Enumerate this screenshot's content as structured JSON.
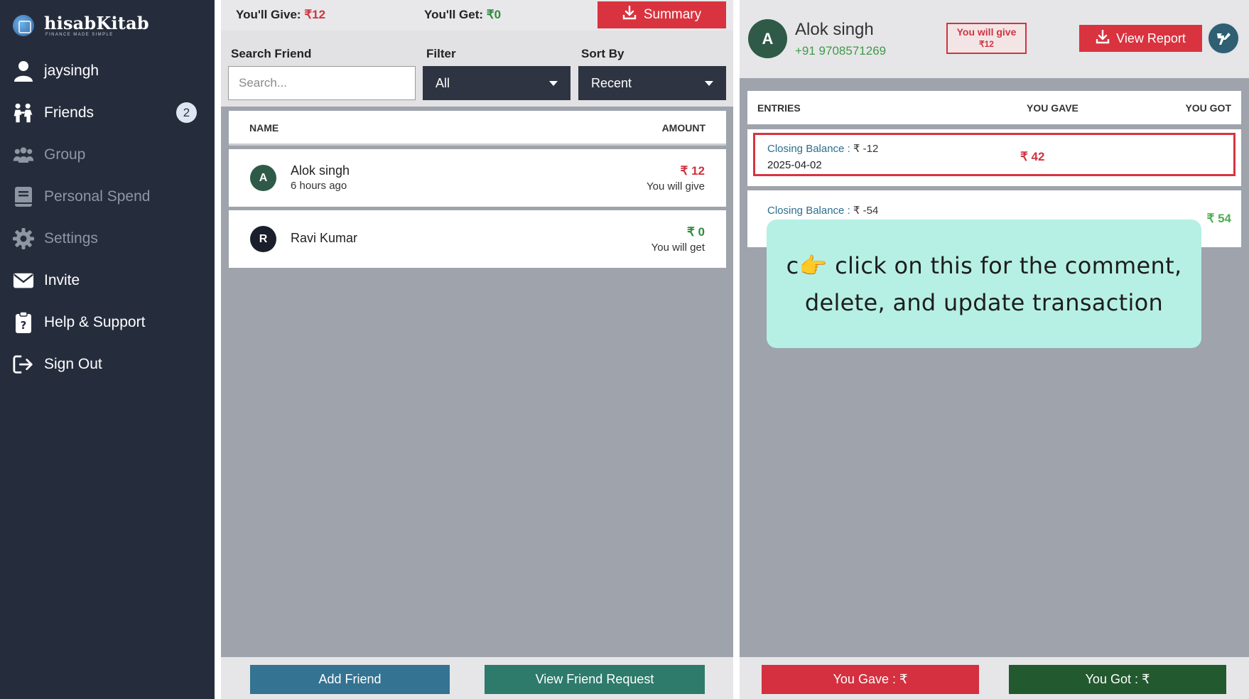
{
  "sidebar": {
    "brand": {
      "name": "hisabKitab",
      "tagline": "FINANCE MADE SIMPLE"
    },
    "items": [
      {
        "label": "jaysingh",
        "icon": "user-icon"
      },
      {
        "label": "Friends",
        "icon": "friends-icon",
        "badge": "2"
      },
      {
        "label": "Group",
        "icon": "group-icon"
      },
      {
        "label": "Personal Spend",
        "icon": "book-icon"
      },
      {
        "label": "Settings",
        "icon": "gear-icon"
      },
      {
        "label": "Invite",
        "icon": "envelope-icon"
      },
      {
        "label": "Help & Support",
        "icon": "clipboard-question-icon"
      },
      {
        "label": "Sign Out",
        "icon": "sign-out-icon"
      }
    ]
  },
  "summary_bar": {
    "give_label": "You'll Give:",
    "give_value": "₹12",
    "get_label": "You'll Get:",
    "get_value": "₹0",
    "summary_button": "Summary"
  },
  "filters": {
    "search_label": "Search Friend",
    "search_placeholder": "Search...",
    "filter_label": "Filter",
    "filter_value": "All",
    "sort_label": "Sort By",
    "sort_value": "Recent"
  },
  "friend_list": {
    "columns": [
      "NAME",
      "AMOUNT"
    ],
    "rows": [
      {
        "initial": "A",
        "name": "Alok singh",
        "subtitle": "6 hours ago",
        "amount": "₹ 12",
        "status": "You will give"
      },
      {
        "initial": "R",
        "name": "Ravi Kumar",
        "subtitle": "",
        "amount": "₹ 0",
        "status": "You will get"
      }
    ],
    "add_friend_button": "Add Friend",
    "view_request_button": "View Friend Request"
  },
  "detail": {
    "initial": "A",
    "name": "Alok singh",
    "phone": "+91 9708571269",
    "badge_line1": "You will give",
    "badge_line2": "₹12",
    "view_report_button": "View Report",
    "columns": [
      "ENTRIES",
      "YOU GAVE",
      "YOU GOT"
    ],
    "entries": [
      {
        "label": "Closing Balance :",
        "balance": "₹ -12",
        "date": "2025-04-02",
        "gave": "₹ 42",
        "got": ""
      },
      {
        "label": "Closing Balance :",
        "balance": "₹ -54",
        "date": "",
        "gave": "",
        "got": "₹ 54"
      }
    ],
    "tooltip_line1": "c👉 click on this  for the comment,",
    "tooltip_line2": "delete, and update transaction",
    "you_gave_button": "You Gave : ₹",
    "you_got_button": "You Got : ₹"
  },
  "colors": {
    "sidebar_bg": "#252d3d",
    "accent_red": "#d9333f",
    "accent_green": "#2e8b3e",
    "tooltip_bg": "#b6f0e4"
  }
}
